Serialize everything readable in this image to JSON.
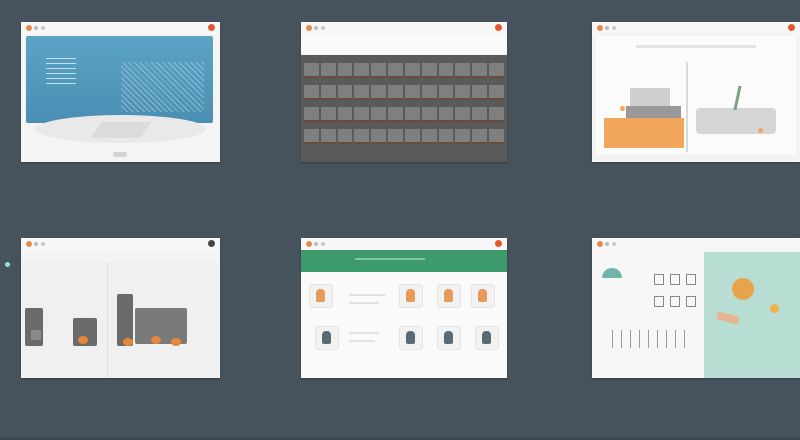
{
  "colors": {
    "desktop_bg": "#46535c",
    "accent_orange": "#e8884f",
    "close_red": "#e4572e",
    "window1_panel": "#5ba3c4",
    "window5_header": "#3d9a6a",
    "window6_panel": "#b8ddd3"
  },
  "windows": [
    {
      "name": "blue-dashboard-window"
    },
    {
      "name": "data-table-window"
    },
    {
      "name": "interior-scene-window"
    },
    {
      "name": "industrial-machines-window"
    },
    {
      "name": "profile-cards-window"
    },
    {
      "name": "outdoor-lounge-window"
    }
  ],
  "icons": {
    "window_controls": [
      "orange-dot-icon",
      "gray-dot-icon",
      "gray-dot-icon"
    ],
    "close": "close-icon"
  }
}
